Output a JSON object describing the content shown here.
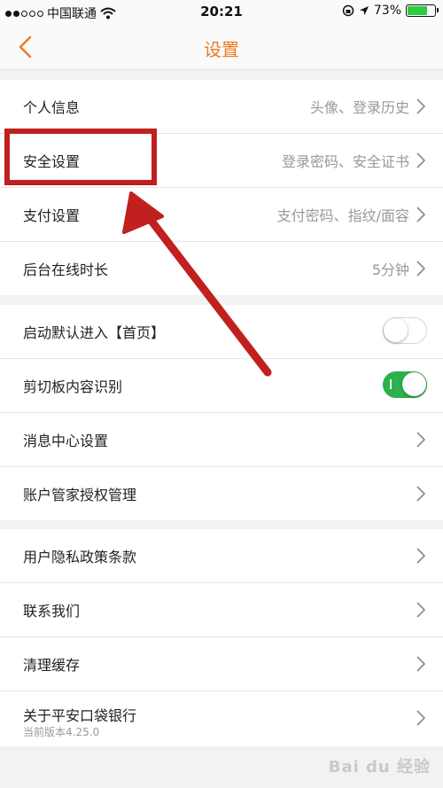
{
  "status_bar": {
    "carrier": "中国联通",
    "time": "20:21",
    "battery": "73%",
    "battery_level": 0.73,
    "signal_bars_filled": 2,
    "signal_bars_total": 5
  },
  "nav": {
    "title": "设置",
    "back_icon": "chevron-left-icon",
    "accent": "#f07a20"
  },
  "group1": [
    {
      "label": "个人信息",
      "value": "头像、登录历史"
    },
    {
      "label": "安全设置",
      "value": "登录密码、安全证书"
    },
    {
      "label": "支付设置",
      "value": "支付密码、指纹/面容"
    },
    {
      "label": "后台在线时长",
      "value": "5分钟"
    }
  ],
  "group2": {
    "toggle_home": {
      "label": "启动默认进入【首页】",
      "on": false
    },
    "toggle_clipboard": {
      "label": "剪切板内容识别",
      "on": true
    },
    "message_center": {
      "label": "消息中心设置"
    },
    "account_auth": {
      "label": "账户管家授权管理"
    }
  },
  "group3": {
    "privacy": {
      "label": "用户隐私政策条款"
    },
    "contact": {
      "label": "联系我们"
    },
    "clear_cache": {
      "label": "清理缓存"
    },
    "about": {
      "label": "关于平安口袋银行",
      "version": "当前版本4.25.0"
    }
  },
  "annotation": {
    "color": "#c0201e"
  },
  "watermark": "Bai du 经验"
}
